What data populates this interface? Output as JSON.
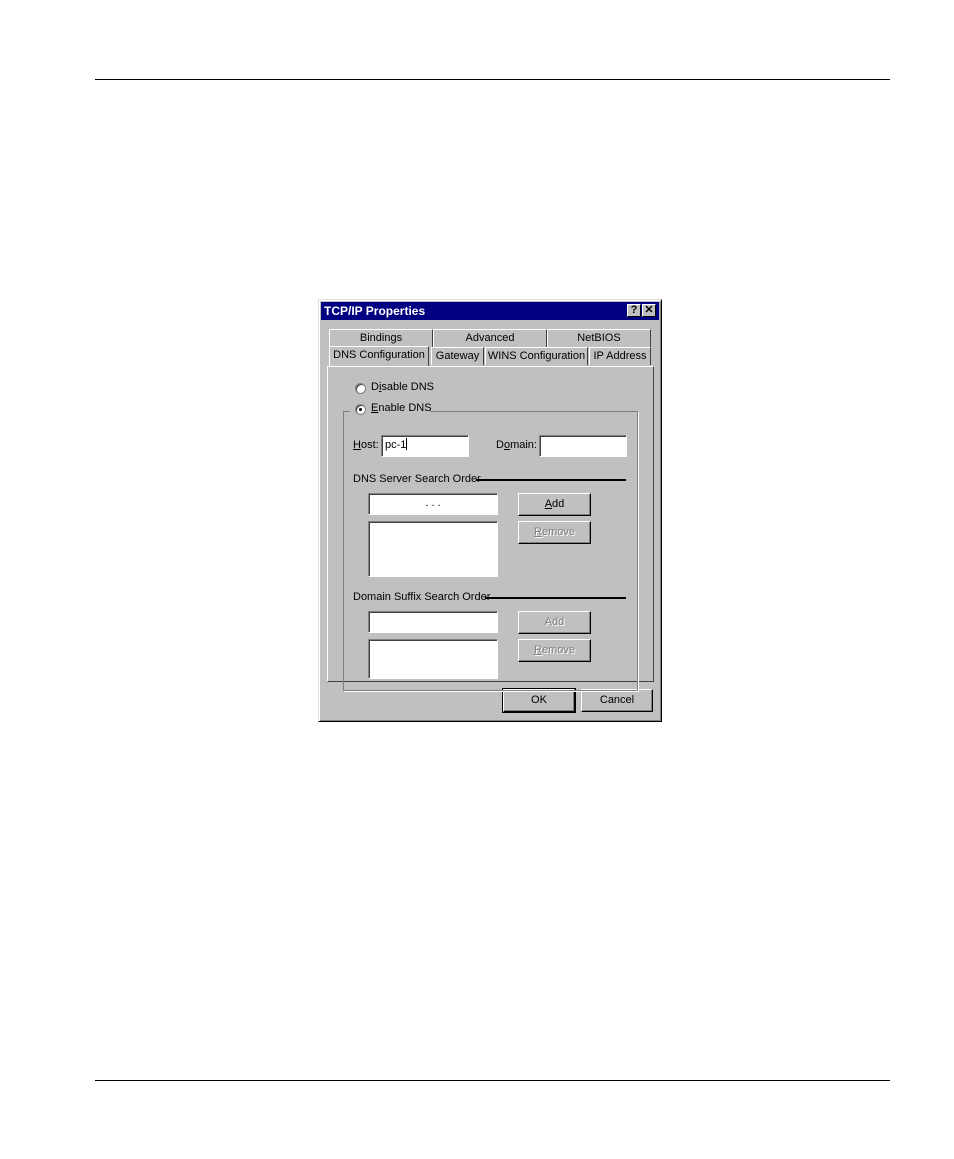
{
  "dialog": {
    "title": "TCP/IP Properties",
    "help_button": "?",
    "close_button": "✕"
  },
  "tabs": {
    "back_row": [
      "Bindings",
      "Advanced",
      "NetBIOS"
    ],
    "front_row": [
      "DNS Configuration",
      "Gateway",
      "WINS Configuration",
      "IP Address"
    ],
    "active": "DNS Configuration"
  },
  "dns": {
    "disable_label_pre": "D",
    "disable_label_u": "i",
    "disable_label_post": "sable DNS",
    "enable_label_u": "E",
    "enable_label_post": "nable DNS",
    "selected": "Enable DNS",
    "host_label_u": "H",
    "host_label_post": "ost:",
    "host_value": "pc-1",
    "domain_label_pre": "D",
    "domain_label_u": "o",
    "domain_label_post": "main:",
    "domain_value": "",
    "server_order_label": "DNS Server Search Order",
    "ip_dots": ".        .        .",
    "add_u": "A",
    "add_post": "dd",
    "remove_u": "R",
    "remove_post": "emove",
    "suffix_order_label": "Domain Suffix Search Order",
    "suffix_add": "Add",
    "suffix_remove_u": "R",
    "suffix_remove_post": "emove"
  },
  "footer": {
    "ok": "OK",
    "cancel": "Cancel"
  }
}
